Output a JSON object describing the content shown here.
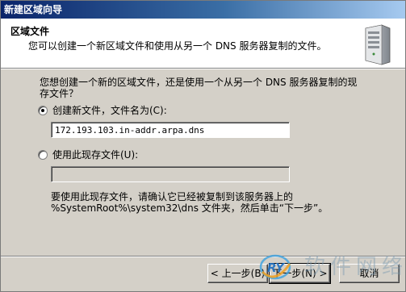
{
  "window": {
    "title": "新建区域向导"
  },
  "header": {
    "title": "区域文件",
    "subtitle": "您可以创建一个新区域文件和使用从另一个 DNS 服务器复制的文件。"
  },
  "main": {
    "question": "您想创建一个新的区域文件，还是使用一个从另一个 DNS 服务器复制的现存文件？",
    "option_create_label": "创建新文件，文件名为(C):",
    "create_filename_value": "172.193.103.in-addr.arpa.dns",
    "option_existing_label": "使用此现存文件(U):",
    "existing_filename_value": "",
    "note": "要使用此现存文件，请确认它已经被复制到该服务器上的 %SystemRoot%\\system32\\dns 文件夹，然后单击“下一步”。"
  },
  "footer": {
    "back_label": "< 上一步(B)",
    "next_label": "下一步(N) >",
    "cancel_label": "取消"
  },
  "watermark": {
    "text": "软件网络",
    "logo_text": "RY"
  },
  "colors": {
    "title_bar": "#0a246a",
    "face": "#d4d0c8",
    "header_bg": "#ffffff"
  }
}
